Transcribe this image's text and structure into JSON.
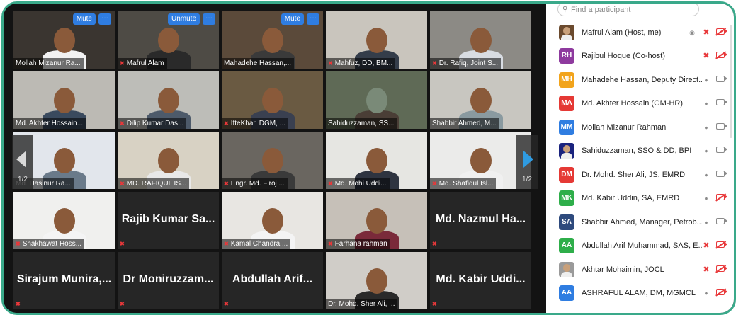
{
  "colors": {
    "accent": "#2f7de1",
    "frame": "#3aa98a",
    "muted": "#e8383a",
    "active_speaker": "#e8d23a"
  },
  "gallery": {
    "page_indicator_left": "1/2",
    "page_indicator_right": "1/2",
    "hover_controls": {
      "mute_label": "Mute",
      "unmute_label": "Unmute",
      "more_label": "···"
    },
    "tiles": [
      {
        "name": "Mollah Mizanur Ra...",
        "muted": false,
        "video": true
      },
      {
        "name": "Mafrul Alam",
        "muted": true,
        "video": true
      },
      {
        "name": "Mahadehe Hassan,...",
        "muted": false,
        "video": true
      },
      {
        "name": "Mahfuz, DD, BM...",
        "muted": true,
        "video": true
      },
      {
        "name": "Dr. Rafiq, Joint S...",
        "muted": true,
        "video": true
      },
      {
        "name": "Md. Akhter Hossain...",
        "muted": false,
        "video": true
      },
      {
        "name": "Dilip Kumar Das...",
        "muted": true,
        "video": true
      },
      {
        "name": "IfteKhar, DGM, ...",
        "muted": true,
        "video": true
      },
      {
        "name": "Sahiduzzaman, SS...",
        "muted": false,
        "video": true
      },
      {
        "name": "Shabbir Ahmed, M...",
        "muted": false,
        "video": true
      },
      {
        "name": "Md. Hasinur Ra...",
        "muted": false,
        "video": true
      },
      {
        "name": "MD. RAFIQUL IS...",
        "muted": true,
        "video": true
      },
      {
        "name": "Engr. Md. Firoj ...",
        "muted": true,
        "video": true
      },
      {
        "name": "Md. Mohi Uddi...",
        "muted": true,
        "video": true
      },
      {
        "name": "Md. Shafiqul Isl...",
        "muted": true,
        "video": true
      },
      {
        "name": "Shakhawat Hoss...",
        "muted": true,
        "video": true
      },
      {
        "big_name": "Rajib Kumar Sa...",
        "muted": true,
        "video": false
      },
      {
        "name": "Kamal Chandra ...",
        "muted": true,
        "video": true
      },
      {
        "name": "Farhana rahman",
        "muted": true,
        "video": true
      },
      {
        "big_name": "Md. Nazmul Ha...",
        "muted": true,
        "video": false
      },
      {
        "big_name": "Sirajum Munira,...",
        "muted": true,
        "video": false
      },
      {
        "big_name": "Dr Moniruzzam...",
        "muted": true,
        "video": false
      },
      {
        "big_name": "Abdullah Arif...",
        "muted": true,
        "video": false
      },
      {
        "name": "Dr. Mohd. Sher Ali, ...",
        "muted": false,
        "video": true
      },
      {
        "big_name": "Md. Kabir Uddi...",
        "muted": true,
        "video": false
      }
    ]
  },
  "participants_panel": {
    "search_placeholder": "Find a participant",
    "participants": [
      {
        "name": "Mafrul Alam (Host, me)",
        "initials": "",
        "avatar_color": "#6b4a2e",
        "mic": "off",
        "video": "off",
        "photo": true
      },
      {
        "name": "Rajibul Hoque (Co-host)",
        "initials": "RH",
        "avatar_color": "#8e3a9e",
        "mic": "off",
        "video": "off"
      },
      {
        "name": "Mahadehe Hassan, Deputy Direct...",
        "initials": "MH",
        "avatar_color": "#f2a41c",
        "mic": "on",
        "video": "on"
      },
      {
        "name": "Md. Akhter Hossain (GM-HR)",
        "initials": "MA",
        "avatar_color": "#e53935",
        "mic": "on",
        "video": "on"
      },
      {
        "name": "Mollah Mizanur Rahman",
        "initials": "MM",
        "avatar_color": "#2f7de1",
        "mic": "on",
        "video": "on"
      },
      {
        "name": "Sahiduzzaman, SSO & DD, BPI",
        "initials": "",
        "avatar_color": "#1a237e",
        "mic": "on",
        "video": "on",
        "photo": true
      },
      {
        "name": "Dr. Mohd. Sher Ali, JS, EMRD",
        "initials": "DM",
        "avatar_color": "#e53935",
        "mic": "on",
        "video": "on"
      },
      {
        "name": "Md. Kabir Uddin, SA, EMRD",
        "initials": "MK",
        "avatar_color": "#2eae4a",
        "mic": "on",
        "video": "off"
      },
      {
        "name": "Shabbir Ahmed, Manager, Petrob...",
        "initials": "SA",
        "avatar_color": "#2e4a7d",
        "mic": "on",
        "video": "on"
      },
      {
        "name": "Abdullah Arif Muhammad, SAS, E...",
        "initials": "AA",
        "avatar_color": "#2eae4a",
        "mic": "off",
        "video": "off"
      },
      {
        "name": "Akhtar Mohaimin, JOCL",
        "initials": "",
        "avatar_color": "#9a9a9a",
        "mic": "off",
        "video": "off",
        "photo": true
      },
      {
        "name": "ASHRAFUL ALAM, DM, MGMCL",
        "initials": "AA",
        "avatar_color": "#2f7de1",
        "mic": "on",
        "video": "off"
      }
    ]
  }
}
